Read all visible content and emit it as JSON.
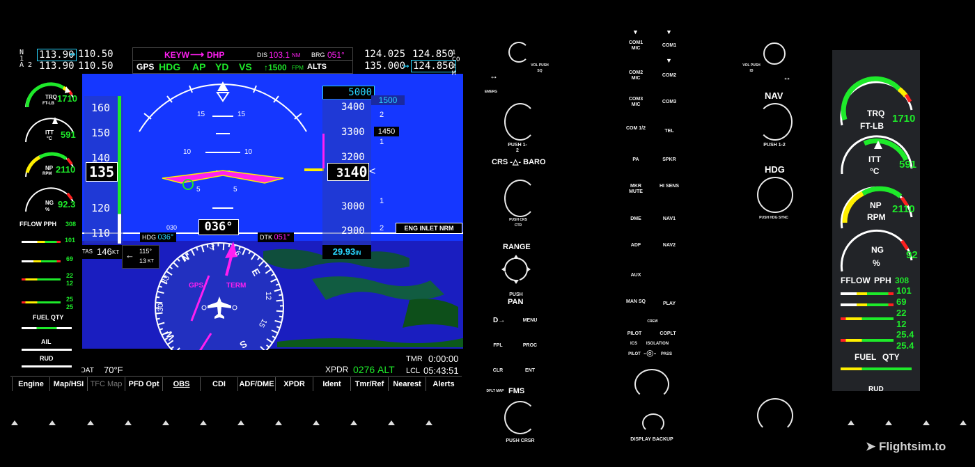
{
  "pfd": {
    "nav1_label": "N 1",
    "nav2_label": "A 2",
    "nav1_active": "113.90",
    "nav1_standby": "110.50",
    "nav2_active": "113.90",
    "nav2_standby": "110.50",
    "swap_arrow": "↔",
    "flight_plan_from": "KEYW",
    "flight_plan_arrow": "⟶",
    "flight_plan_to": "DHP",
    "dis_label": "DIS",
    "dis_value": "103.1",
    "dis_unit": "NM",
    "brg_label": "BRG",
    "brg_value": "051°",
    "nav_source": "GPS",
    "lateral_mode": "HDG",
    "ap_label": "AP",
    "yd_label": "YD",
    "vs_label": "VS",
    "vs_target": "↑1500",
    "vs_unit": "FPM",
    "alts_label": "ALTS",
    "com1_active": "124.025",
    "com1_standby": "124.850",
    "com2_active": "135.000",
    "com2_standby": "124.850",
    "com_labels": [
      "1 C",
      "O",
      "2 M"
    ],
    "airspeed_tape": [
      "160",
      "150",
      "140",
      "120",
      "110"
    ],
    "airspeed_current": "135",
    "pitch_labels": [
      "15",
      "15",
      "10",
      "10",
      "5",
      "5"
    ],
    "altitude_selected": "5000",
    "altitude_tape": [
      "3400",
      "3300",
      "3200",
      "3000",
      "2900"
    ],
    "altitude_current_major": "31",
    "altitude_current_minor": "40",
    "vs_tape": [
      "2",
      "1",
      "1",
      "2"
    ],
    "vs_bug": "1500",
    "vs_current": "1450",
    "baro_setting": "29.93",
    "baro_unit": "IN",
    "tas_label": "TAS",
    "tas_value": "146",
    "tas_unit": "KT",
    "wind_dir": "115°",
    "wind_speed": "13",
    "wind_unit": "KT",
    "hdg_label": "HDG",
    "hdg_bug": "036°",
    "heading_current": "036°",
    "heading_small_label": "030",
    "dtk_label": "DTK",
    "dtk_value": "051°",
    "compass_cardinals": [
      "N",
      "E",
      "S",
      "W",
      "33",
      "30",
      "24",
      "21",
      "15",
      "12",
      "6",
      "3"
    ],
    "cdi_source": "GPS",
    "cdi_mode": "TERM",
    "cas_message": "ENG INLET NRM",
    "oat_label": "OAT",
    "oat_value": "70°F",
    "xpdr_label": "XPDR",
    "xpdr_code": "0276",
    "xpdr_mode": "ALT",
    "tmr_label": "TMR",
    "tmr_value": "0:00:00",
    "lcl_label": "LCL",
    "lcl_value": "05:43:51"
  },
  "eis_left": {
    "trq_label": "TRQ",
    "trq_unit": "FT-LB",
    "trq_value": "1710",
    "itt_label": "ITT",
    "itt_unit": "°C",
    "itt_value": "591",
    "np_label": "NP",
    "np_unit": "RPM",
    "np_value": "2110",
    "ng_label": "NG",
    "ng_unit": "%",
    "ng_value": "92.3",
    "fflow_label": "FFLOW PPH",
    "fflow_value": "308",
    "gauge_values": [
      "101",
      "69",
      "22",
      "12",
      "25",
      "25"
    ],
    "fuel_label": "FUEL QTY",
    "ail_label": "AIL",
    "rud_label": "RUD"
  },
  "softkeys": [
    "Engine",
    "Map/HSI",
    "TFC Map",
    "PFD Opt",
    "OBS",
    "CDI",
    "ADF/DME",
    "XPDR",
    "Ident",
    "Tmr/Ref",
    "Nearest",
    "Alerts"
  ],
  "bezel_left": {
    "vol_label": "VOL PUSH SQ",
    "emerg_label": "EMERG",
    "push12_label": "PUSH 1-2",
    "crs_label": "CRS",
    "baro_label": "BARO",
    "push_crs_ctr": "PUSH CRS CTR",
    "range_label": "RANGE",
    "push_label": "PUSH",
    "pan_label": "PAN",
    "direct_label": "D→",
    "menu_label": "MENU",
    "fpl_label": "FPL",
    "proc_label": "PROC",
    "clr_label": "CLR",
    "ent_label": "ENT",
    "dfltmap_label": "DFLT MAP",
    "fms_label": "FMS",
    "push_crsr": "PUSH CRSR"
  },
  "audio_panel": {
    "left_col": [
      "COM1 MIC",
      "COM2 MIC",
      "COM3 MIC",
      "COM 1/2",
      "PA",
      "MKR MUTE",
      "DME",
      "ADF",
      "AUX",
      "MAN SQ"
    ],
    "right_col": [
      "COM1",
      "COM2",
      "COM3",
      "TEL",
      "SPKR",
      "HI SENS",
      "NAV1",
      "NAV2",
      "",
      "PLAY"
    ],
    "crew_label": "CREW",
    "pilot_label": "PILOT",
    "coplt_label": "COPLT",
    "ics_label": "ICS",
    "isolation_label": "ISOLATION",
    "pilot2_label": "PILOT",
    "pass_label": "PASS",
    "display_backup": "DISPLAY BACKUP"
  },
  "bezel_right": {
    "vol_label": "VOL PUSH ID",
    "nav_label": "NAV",
    "push12_label": "PUSH 1-2",
    "hdg_label": "HDG",
    "push_hdg_sync": "PUSH HDG SYNC"
  },
  "eis_right": {
    "trq_label": "TRQ",
    "trq_unit": "FT-LB",
    "trq_value": "1710",
    "itt_label": "ITT",
    "itt_unit": "°C",
    "itt_value": "591",
    "np_label": "NP",
    "np_unit": "RPM",
    "np_value": "2110",
    "ng_label": "NG",
    "ng_unit": "%",
    "ng_value": "92",
    "fflow_label": "FFLOW",
    "pph_label": "PPH",
    "fflow_value": "308",
    "values": [
      "101",
      "69",
      "22",
      "12",
      "25.4",
      "25.4"
    ],
    "fuel_label": "FUEL",
    "qty_label": "QTY",
    "rud_label": "RUD"
  },
  "watermark": "Flightsim.to"
}
